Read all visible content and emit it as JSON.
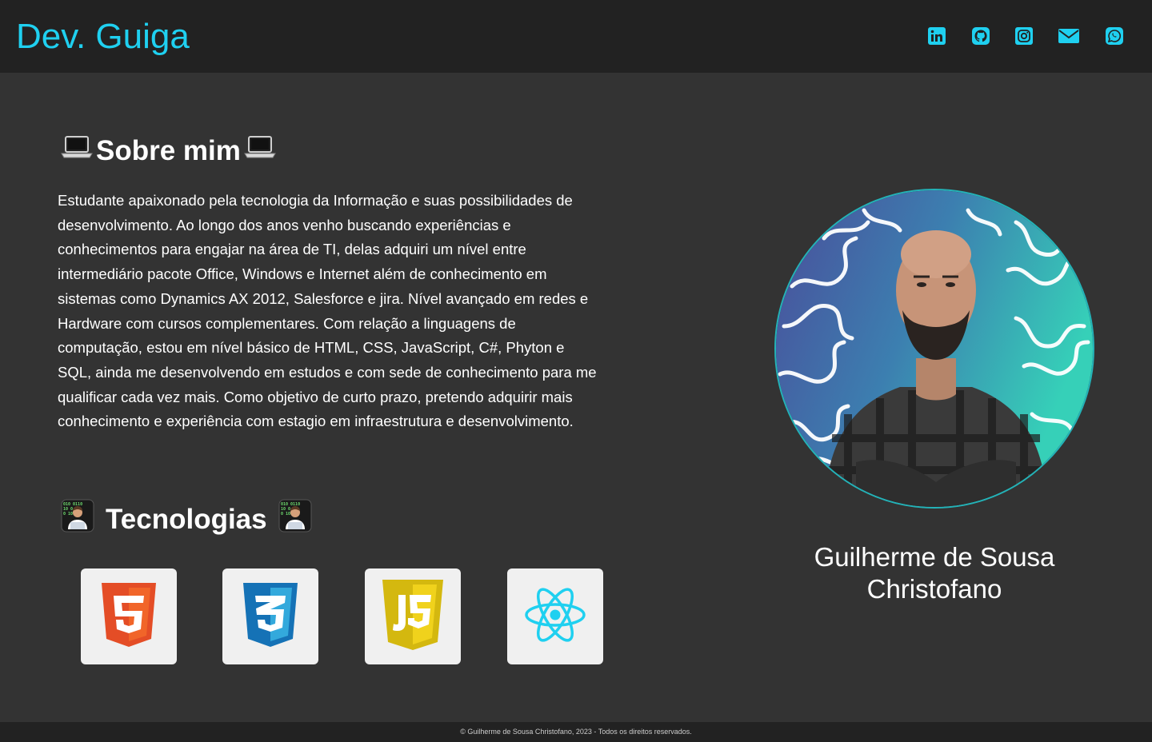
{
  "header": {
    "logo": "Dev. Guiga",
    "social": [
      {
        "name": "linkedin-icon"
      },
      {
        "name": "github-icon"
      },
      {
        "name": "instagram-icon"
      },
      {
        "name": "email-icon"
      },
      {
        "name": "whatsapp-icon"
      }
    ],
    "accent_color": "#1fd0f0"
  },
  "about": {
    "title": "Sobre mim",
    "title_emoji": "laptop-icon",
    "text": "Estudante apaixonado pela tecnologia da Informação e suas possibilidades de desenvolvimento. Ao longo dos anos venho buscando experiências e conhecimentos para engajar na área de TI, delas adquiri um nível entre intermediário pacote Office, Windows e Internet além de conhecimento em sistemas como Dynamics AX 2012, Salesforce e jira. Nível avançado em redes e Hardware com cursos complementares. Com relação a linguagens de computação, estou em nível básico de HTML, CSS, JavaScript, C#, Phyton e SQL, ainda me desenvolvendo em estudos e com sede de conhecimento para me qualificar cada vez mais. Como objetivo de curto prazo, pretendo adquirir mais conhecimento e experiência com estagio em infraestrutura e desenvolvimento."
  },
  "technologies": {
    "title": "Tecnologias",
    "title_emoji": "technologist-icon",
    "items": [
      {
        "name": "html5-icon"
      },
      {
        "name": "css3-icon"
      },
      {
        "name": "javascript-icon"
      },
      {
        "name": "react-icon"
      }
    ]
  },
  "profile": {
    "name": "Guilherme de Sousa Christofano"
  },
  "footer": {
    "text": "© Guilherme de Sousa Christofano, 2023 - Todos os direitos reservados."
  }
}
